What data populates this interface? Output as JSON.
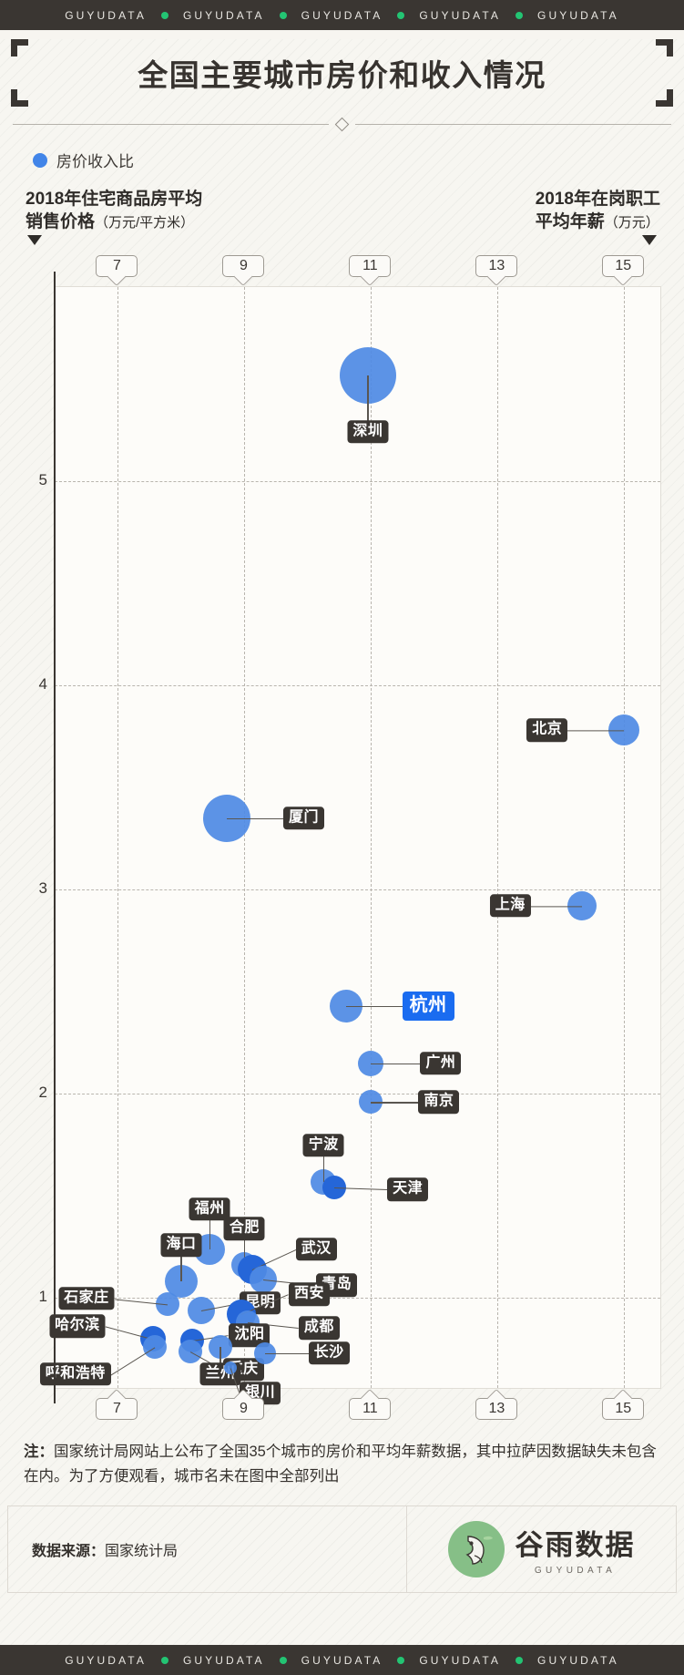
{
  "brand": {
    "strip_text": "GUYUDATA",
    "repeats": 5,
    "dot_color": "#23c473",
    "strip_bg": "#3a3632"
  },
  "header": {
    "title": "全国主要城市房价和收入情况"
  },
  "legend": {
    "label": "房价收入比",
    "color": "#4285e8"
  },
  "axes": {
    "left_heading_main": "2018年住宅商品房平均",
    "left_heading_second": "销售价格",
    "left_heading_unit": "（万元/平方米）",
    "right_heading_main": "2018年在岗职工",
    "right_heading_second": "平均年薪",
    "right_heading_unit": "（万元）",
    "x_ticks": [
      "7",
      "9",
      "11",
      "13",
      "15"
    ],
    "y_ticks": [
      "5",
      "4",
      "3",
      "2",
      "1"
    ]
  },
  "note": {
    "prefix": "注：",
    "text": "国家统计局网站上公布了全国35个城市的房价和平均年薪数据，其中拉萨因数据缺失未包含在内。为了方便观看，城市名未在图中全部列出"
  },
  "footer": {
    "source_label": "数据来源：",
    "source_value": "国家统计局",
    "logo_cn": "谷雨数据",
    "logo_en": "GUYUDATA"
  },
  "chart_data": {
    "type": "scatter",
    "title": "全国主要城市房价和收入情况",
    "xlabel": "2018年在岗职工平均年薪（万元）",
    "ylabel": "2018年住宅商品房平均销售价格（万元/平方米）",
    "bubble_meaning": "房价收入比",
    "xlim": [
      6.0,
      15.6
    ],
    "ylim": [
      0.55,
      5.95
    ],
    "xticks": [
      7,
      9,
      11,
      13,
      15
    ],
    "yticks": [
      1,
      2,
      3,
      4,
      5
    ],
    "grid": true,
    "legend_position": "top-left",
    "points": [
      {
        "city": "深圳",
        "x": 10.95,
        "y": 5.52,
        "r": 31,
        "label_dx": 0,
        "label_dy": 62,
        "highlight": false
      },
      {
        "city": "北京",
        "x": 15.0,
        "y": 3.78,
        "r": 17,
        "label_dx": -62,
        "label_dy": 0,
        "highlight": false
      },
      {
        "city": "厦门",
        "x": 8.72,
        "y": 3.35,
        "r": 26,
        "label_dx": 62,
        "label_dy": 0,
        "highlight": false
      },
      {
        "city": "上海",
        "x": 14.33,
        "y": 2.92,
        "r": 16,
        "label_dx": -56,
        "label_dy": 0,
        "highlight": false
      },
      {
        "city": "杭州",
        "x": 10.6,
        "y": 2.43,
        "r": 18,
        "label_dx": 62,
        "label_dy": 0,
        "highlight": true
      },
      {
        "city": "广州",
        "x": 11.0,
        "y": 2.15,
        "r": 14,
        "label_dx": 54,
        "label_dy": 0,
        "highlight": false
      },
      {
        "city": "南京",
        "x": 11.0,
        "y": 1.96,
        "r": 13,
        "label_dx": 52,
        "label_dy": 0,
        "highlight": false
      },
      {
        "city": "宁波",
        "x": 10.25,
        "y": 1.57,
        "r": 14,
        "label_dx": 0,
        "label_dy": -40,
        "highlight": false
      },
      {
        "city": "天津",
        "x": 10.42,
        "y": 1.54,
        "r": 13,
        "label_dx": 58,
        "label_dy": 2,
        "highlight": false
      },
      {
        "city": "福州",
        "x": 8.45,
        "y": 1.24,
        "r": 17,
        "label_dx": 0,
        "label_dy": -44,
        "highlight": false
      },
      {
        "city": "合肥",
        "x": 9.0,
        "y": 1.16,
        "r": 14,
        "label_dx": 0,
        "label_dy": -40,
        "highlight": false
      },
      {
        "city": "武汉",
        "x": 9.12,
        "y": 1.14,
        "r": 16,
        "label_dx": 48,
        "label_dy": -22,
        "highlight": false
      },
      {
        "city": "青岛",
        "x": 9.3,
        "y": 1.09,
        "r": 15,
        "label_dx": 58,
        "label_dy": 6,
        "highlight": false
      },
      {
        "city": "海口",
        "x": 8.0,
        "y": 1.08,
        "r": 18,
        "label_dx": 0,
        "label_dy": -40,
        "highlight": false
      },
      {
        "city": "石家庄",
        "x": 7.78,
        "y": 0.97,
        "r": 13,
        "label_dx": -58,
        "label_dy": -6,
        "highlight": false
      },
      {
        "city": "昆明",
        "x": 8.32,
        "y": 0.94,
        "r": 15,
        "label_dx": 42,
        "label_dy": -8,
        "highlight": false
      },
      {
        "city": "西安",
        "x": 8.95,
        "y": 0.92,
        "r": 16,
        "label_dx": 52,
        "label_dy": -22,
        "highlight": false
      },
      {
        "city": "成都",
        "x": 9.05,
        "y": 0.88,
        "r": 13,
        "label_dx": 56,
        "label_dy": 6,
        "highlight": false
      },
      {
        "city": "哈尔滨",
        "x": 7.55,
        "y": 0.8,
        "r": 14,
        "label_dx": -52,
        "label_dy": -14,
        "highlight": false
      },
      {
        "city": "沈阳",
        "x": 8.18,
        "y": 0.79,
        "r": 13,
        "label_dx": 40,
        "label_dy": -6,
        "highlight": false
      },
      {
        "city": "呼和浩特",
        "x": 7.58,
        "y": 0.76,
        "r": 13,
        "label_dx": -48,
        "label_dy": 30,
        "highlight": false
      },
      {
        "city": "重庆",
        "x": 8.14,
        "y": 0.74,
        "r": 13,
        "label_dx": 36,
        "label_dy": 20,
        "highlight": false
      },
      {
        "city": "兰州",
        "x": 8.62,
        "y": 0.76,
        "r": 13,
        "label_dx": 0,
        "label_dy": 30,
        "highlight": false
      },
      {
        "city": "长沙",
        "x": 9.32,
        "y": 0.73,
        "r": 12,
        "label_dx": 48,
        "label_dy": 0,
        "highlight": false
      },
      {
        "city": "银川",
        "x": 8.78,
        "y": 0.66,
        "r": 7,
        "label_dx": 10,
        "label_dy": 28,
        "highlight": false
      }
    ]
  }
}
